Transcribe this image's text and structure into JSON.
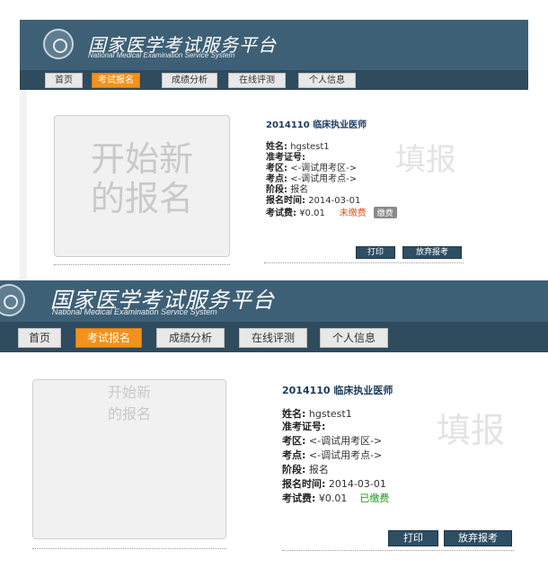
{
  "colors": {
    "header_bg": "#3e6076",
    "nav_bg": "#2f4b5e",
    "active_tab": "#f2921c",
    "button_dark": "#2e4e63",
    "unpaid": "#d9531e",
    "paid": "#1f9a1f",
    "placeholder_text": "#c9c9c9"
  },
  "site": {
    "title": "国家医学考试服务平台",
    "subtitle": "National Medical Examination Service System",
    "emblem_icon": "national-medical-exam-emblem"
  },
  "nav": {
    "items": [
      {
        "label": "首页",
        "active": false
      },
      {
        "label": "考试报名",
        "active": true
      },
      {
        "label": "成绩分析",
        "active": false
      },
      {
        "label": "在线评测",
        "active": false
      },
      {
        "label": "个人信息",
        "active": false
      }
    ]
  },
  "start_card": {
    "line1": "开始新",
    "line2": "的报名"
  },
  "registration": {
    "exam_title": "2014110 临床执业医师",
    "watermark": "填报",
    "name_label": "姓名:",
    "name_value": "hgstest1",
    "ticket_label": "准考证号:",
    "ticket_value": "",
    "area_label": "考区:",
    "area_value": "<-调试用考区->",
    "site_label": "考点:",
    "site_value": "<-调试用考点->",
    "stage_label": "阶段:",
    "stage_value": "报名",
    "time_label": "报名时间:",
    "time_value": "2014-03-01",
    "fee_label": "考试费:",
    "fee_value": "¥0.01"
  },
  "view1": {
    "fee_status": "未缴费",
    "pay_button": "缴费",
    "print_button": "打印",
    "abandon_button": "放弃报考"
  },
  "view2": {
    "fee_status": "已缴费",
    "print_button": "打印",
    "abandon_button": "放弃报考"
  }
}
